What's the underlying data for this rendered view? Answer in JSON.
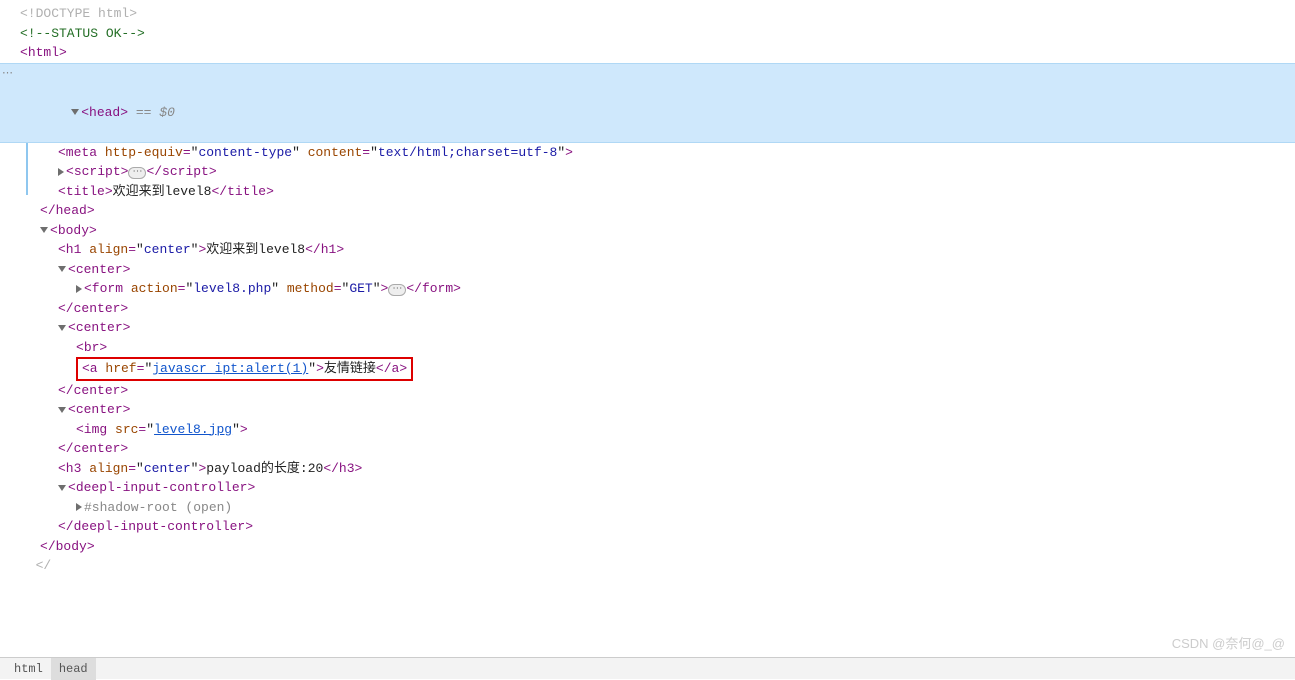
{
  "lines": {
    "doctype": "<!DOCTYPE html>",
    "comment": "<!--STATUS OK-->",
    "html_open": "html",
    "head_open": "head",
    "eq0": " == $0",
    "meta_attr1_n": "http-equiv",
    "meta_attr1_v": "content-type",
    "meta_attr2_n": "content",
    "meta_attr2_v": "text/html;charset=utf-8",
    "script": "script",
    "title_tag": "title",
    "title_text": "欢迎来到level8",
    "head_close": "/head",
    "body_open": "body",
    "h1_attr_n": "align",
    "h1_attr_v": "center",
    "h1_text": "欢迎来到level8",
    "center": "center",
    "form_action_n": "action",
    "form_action_v": "level8.php",
    "form_method_n": "method",
    "form_method_v": "GET",
    "br": "br",
    "a_href_n": "href",
    "a_href_v": "javascr_ipt:alert(1)",
    "a_text": "友情链接",
    "img_src_n": "src",
    "img_src_v": "level8.jpg",
    "h3_attr_n": "align",
    "h3_attr_v": "center",
    "h3_text": "payload的长度:20",
    "deepl": "deepl-input-controller",
    "shadow": "#shadow-root (open)",
    "body_close": "/body"
  },
  "breadcrumb": {
    "html": "html",
    "head": "head"
  },
  "watermark": "CSDN @奈何@_@"
}
